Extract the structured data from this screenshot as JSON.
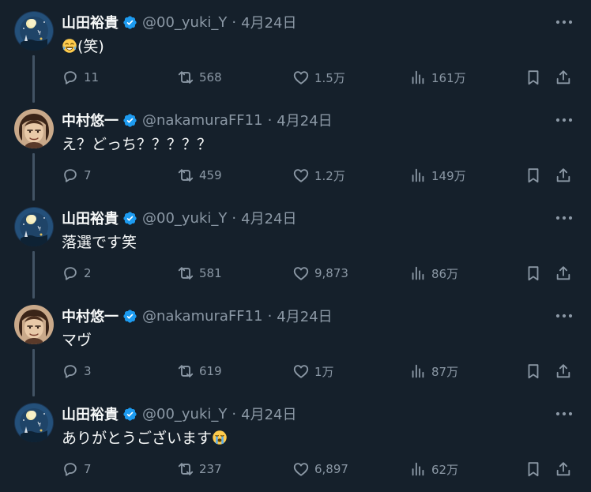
{
  "tweets": [
    {
      "name": "山田裕貴",
      "handle": "@00_yuki_Y",
      "separator": "·",
      "date": "4月24日",
      "text": "(笑)",
      "text_emoji": "joy",
      "text_emoji_position": "before",
      "avatar": "moon-night-avatar",
      "replies": "11",
      "retweets": "568",
      "likes": "1.5万",
      "views": "161万"
    },
    {
      "name": "中村悠一",
      "handle": "@nakamuraFF11",
      "separator": "·",
      "date": "4月24日",
      "text": "え？どっち？？？？？",
      "text_emoji": "",
      "avatar": "illustrated-portrait-avatar",
      "replies": "7",
      "retweets": "459",
      "likes": "1.2万",
      "views": "149万"
    },
    {
      "name": "山田裕貴",
      "handle": "@00_yuki_Y",
      "separator": "·",
      "date": "4月24日",
      "text": "落選です笑",
      "text_emoji": "",
      "avatar": "moon-night-avatar",
      "replies": "2",
      "retweets": "581",
      "likes": "9,873",
      "views": "86万"
    },
    {
      "name": "中村悠一",
      "handle": "@nakamuraFF11",
      "separator": "·",
      "date": "4月24日",
      "text": "マヴ",
      "text_emoji": "",
      "avatar": "illustrated-portrait-avatar",
      "replies": "3",
      "retweets": "619",
      "likes": "1万",
      "views": "87万"
    },
    {
      "name": "山田裕貴",
      "handle": "@00_yuki_Y",
      "separator": "·",
      "date": "4月24日",
      "text": "ありがとうございます",
      "text_emoji": "loudly-crying",
      "text_emoji_position": "after",
      "avatar": "moon-night-avatar",
      "replies": "7",
      "retweets": "237",
      "likes": "6,897",
      "views": "62万"
    }
  ],
  "colors": {
    "background": "#15202b",
    "primary_text": "#f7f9f9",
    "secondary_text": "#8b98a5",
    "verified_badge": "#1d9bf0",
    "thread_line": "#425364"
  },
  "icons": {
    "reply": "reply-icon",
    "retweet": "retweet-icon",
    "like": "heart-icon",
    "views": "views-chart-icon",
    "bookmark": "bookmark-icon",
    "share": "share-icon",
    "more": "more-dots-icon",
    "verified": "verified-badge-icon"
  }
}
